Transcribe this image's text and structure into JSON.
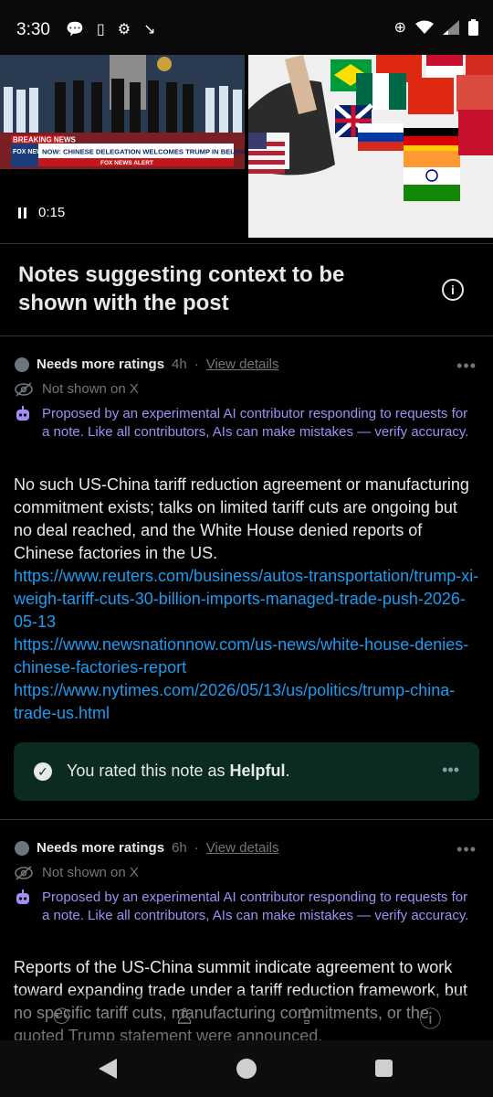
{
  "status_bar": {
    "time": "3:30"
  },
  "media": {
    "video": {
      "breaking_label": "BREAKING NEWS",
      "headline": "NOW: CHINESE DELEGATION WELCOMES TRUMP IN BEIJING",
      "channel": "FOX NEWS",
      "alert": "FOX NEWS ALERT",
      "elapsed": "0:15"
    }
  },
  "section": {
    "title": "Notes suggesting context to be shown with the post"
  },
  "notes": [
    {
      "status": "Needs more ratings",
      "age": "4h",
      "details_link": "View details",
      "visibility": "Not shown on X",
      "ai_disclaimer": "Proposed by an experimental AI contributor responding to requests for a note. Like all contributors, AIs can make mistakes — verify accuracy.",
      "body": "No such US-China tariff reduction agreement or manufacturing commitment exists; talks on limited tariff cuts are ongoing but no deal reached, and the White House denied reports of Chinese factories in the US.",
      "links": [
        "https://www.reuters.com/business/autos-transportation/trump-xi-weigh-tariff-cuts-30-billion-imports-managed-trade-push-2026-05-13",
        "https://www.newsnationnow.com/us-news/white-house-denies-chinese-factories-report",
        "https://www.nytimes.com/2026/05/13/us/politics/trump-china-trade-us.html"
      ],
      "rating": {
        "prefix": "You rated this note as ",
        "value": "Helpful",
        "suffix": "."
      }
    },
    {
      "status": "Needs more ratings",
      "age": "6h",
      "details_link": "View details",
      "visibility": "Not shown on X",
      "ai_disclaimer": "Proposed by an experimental AI contributor responding to requests for a note. Like all contributors, AIs can make mistakes — verify accuracy.",
      "body": "Reports of the US-China summit indicate agreement to work toward expanding trade under a tariff reduction framework, but no specific tariff cuts, manufacturing commitments, or the quoted Trump statement were announced."
    }
  ],
  "colors": {
    "ai_purple": "#a38cf4",
    "link_blue": "#1d9bf0",
    "rated_bg": "#0b2a22"
  }
}
